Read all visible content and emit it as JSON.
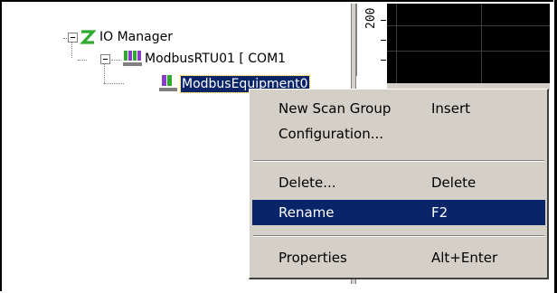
{
  "tree": {
    "root_label": "IO Manager",
    "child_label": "ModbusRTU01 [ COM1",
    "grandchild_label": "ModbusEquipment0"
  },
  "graph": {
    "axis_label": "200"
  },
  "context_menu": {
    "items": [
      {
        "label": "New Scan Group",
        "shortcut": "Insert"
      },
      {
        "label": "Configuration...",
        "shortcut": ""
      },
      {
        "label": "Delete...",
        "shortcut": "Delete"
      },
      {
        "label": "Rename",
        "shortcut": "F2"
      },
      {
        "label": "Properties",
        "shortcut": "Alt+Enter"
      }
    ],
    "highlighted": "Rename"
  },
  "colors": {
    "selection": "#0a246a",
    "menu_bg": "#d4d0c8",
    "icon_green": "#2faa2f",
    "icon_purple": "#8a3cc8"
  }
}
